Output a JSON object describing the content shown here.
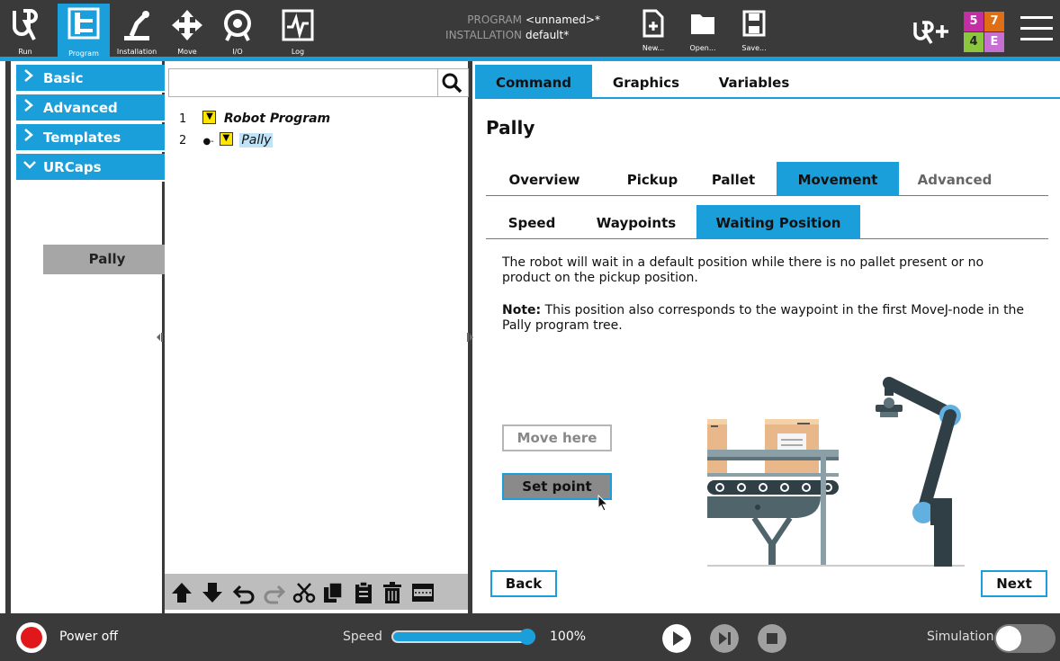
{
  "topbar": {
    "nav": [
      {
        "id": "run",
        "label": "Run"
      },
      {
        "id": "program",
        "label": "Program"
      },
      {
        "id": "installation",
        "label": "Installation"
      },
      {
        "id": "move",
        "label": "Move"
      },
      {
        "id": "io",
        "label": "I/O"
      },
      {
        "id": "log",
        "label": "Log"
      }
    ],
    "program_key": "PROGRAM",
    "program_value": "<unnamed>*",
    "installation_key": "INSTALLATION",
    "installation_value": "default*",
    "file_buttons": [
      {
        "id": "new",
        "label": "New..."
      },
      {
        "id": "open",
        "label": "Open..."
      },
      {
        "id": "save",
        "label": "Save..."
      }
    ],
    "badge": {
      "tl": "5",
      "tr": "7",
      "bl": "4",
      "br": "E"
    },
    "colors": {
      "accent": "#1a9fdb",
      "bar": "#3a3a3a"
    }
  },
  "sidebar": {
    "categories": [
      {
        "label": "Basic",
        "expanded": false
      },
      {
        "label": "Advanced",
        "expanded": false
      },
      {
        "label": "Templates",
        "expanded": false
      },
      {
        "label": "URCaps",
        "expanded": true
      }
    ],
    "sub_items": [
      "Pally"
    ]
  },
  "tree": {
    "search_placeholder": "",
    "rows": [
      {
        "num": "1",
        "label": "Robot Program"
      },
      {
        "num": "2",
        "label": "Pally"
      }
    ]
  },
  "content": {
    "top_tabs": [
      "Command",
      "Graphics",
      "Variables"
    ],
    "title": "Pally",
    "tabs": [
      "Overview",
      "Pickup",
      "Pallet",
      "Movement",
      "Advanced"
    ],
    "subtabs": [
      "Speed",
      "Waypoints",
      "Waiting Position"
    ],
    "description": "The robot will wait in a default position while there is no pallet present or no product on the pickup position.",
    "note_label": "Note:",
    "note_text": " This position also corresponds to the waypoint in the first MoveJ-node in the Pally program tree.",
    "move_here": "Move here",
    "set_point": "Set point",
    "back": "Back",
    "next": "Next"
  },
  "bottombar": {
    "power_label": "Power off",
    "speed_label": "Speed",
    "speed_percent": 100,
    "speed_value": "100%",
    "simulation_label": "Simulation"
  }
}
